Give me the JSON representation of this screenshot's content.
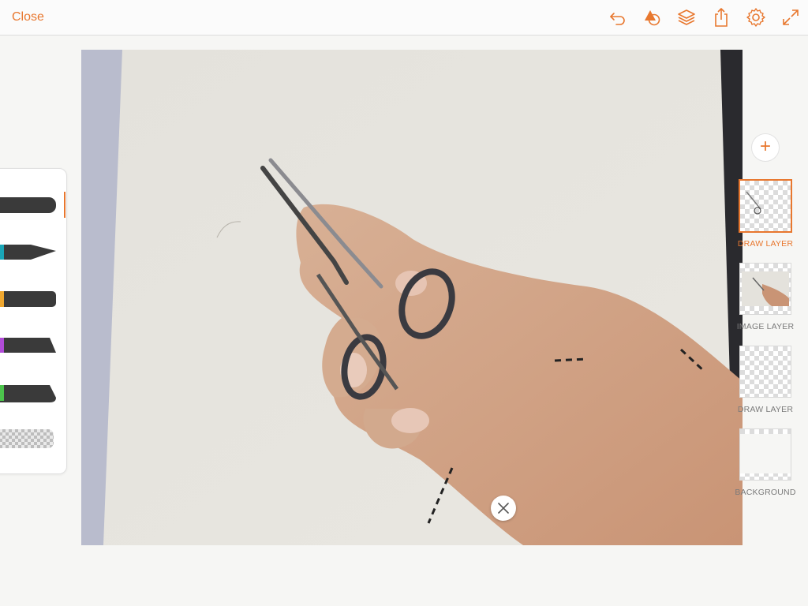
{
  "toolbar": {
    "close_label": "Close",
    "icons": [
      "undo-icon",
      "shapes-icon",
      "layers-icon",
      "share-icon",
      "settings-icon",
      "fullscreen-icon"
    ]
  },
  "colors": {
    "accent": "#e8772e",
    "panel_bg": "#ffffff",
    "app_bg": "#f6f6f4"
  },
  "brushes": [
    {
      "name": "pencil",
      "tip_color": "#3a3a3a"
    },
    {
      "name": "ink-pen",
      "tip_color": "#1aa6b7"
    },
    {
      "name": "marker",
      "tip_color": "#f0a830"
    },
    {
      "name": "paint-brush",
      "tip_color": "#b14cd8"
    },
    {
      "name": "flat-brush",
      "tip_color": "#4cc44c"
    },
    {
      "name": "eraser",
      "tip_color": "#cccccc"
    }
  ],
  "layers": [
    {
      "label": "DRAW LAYER",
      "selected": true
    },
    {
      "label": "IMAGE LAYER",
      "selected": false
    },
    {
      "label": "DRAW LAYER",
      "selected": false
    },
    {
      "label": "BACKGROUND",
      "selected": false
    }
  ]
}
